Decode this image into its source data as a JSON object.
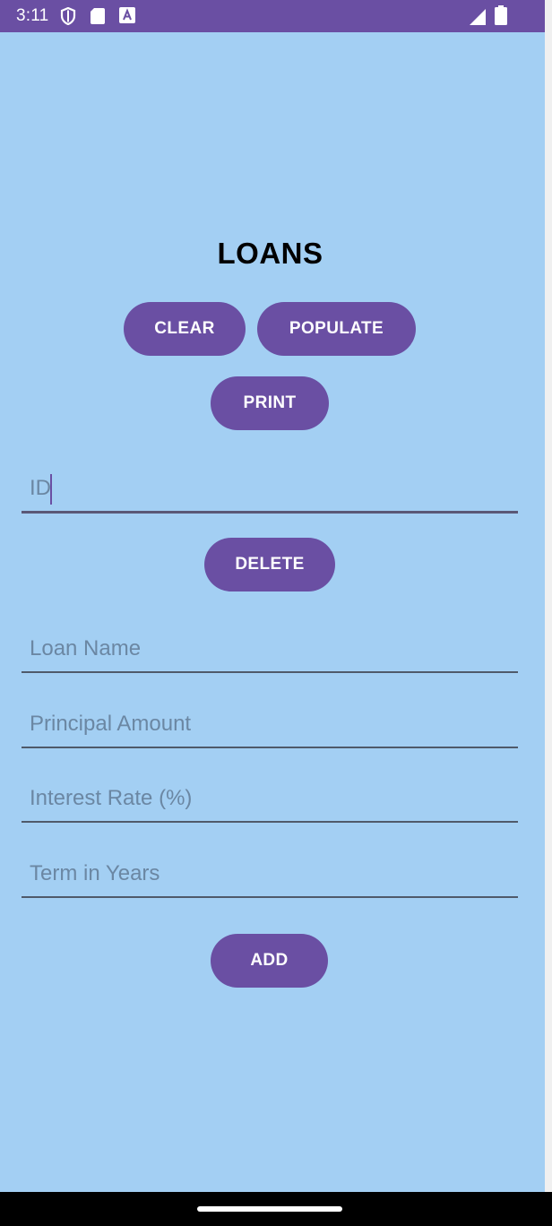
{
  "status_bar": {
    "time": "3:11",
    "icons": [
      "shield-icon",
      "sd-card-icon",
      "keyboard-a-icon",
      "signal-icon",
      "battery-icon"
    ]
  },
  "colors": {
    "background": "#a3cff3",
    "primary": "#6a4fa3",
    "status_bar": "#6a4fa3",
    "nav_bar": "#000000"
  },
  "page": {
    "title": "LOANS"
  },
  "buttons": {
    "clear": "CLEAR",
    "populate": "POPULATE",
    "print": "PRINT",
    "delete": "DELETE",
    "add": "ADD"
  },
  "fields": {
    "id": {
      "placeholder": "ID",
      "value": ""
    },
    "loan_name": {
      "placeholder": "Loan Name",
      "value": ""
    },
    "principal_amount": {
      "placeholder": "Principal Amount",
      "value": ""
    },
    "interest_rate": {
      "placeholder": "Interest Rate (%)",
      "value": ""
    },
    "term_years": {
      "placeholder": "Term in Years",
      "value": ""
    }
  }
}
